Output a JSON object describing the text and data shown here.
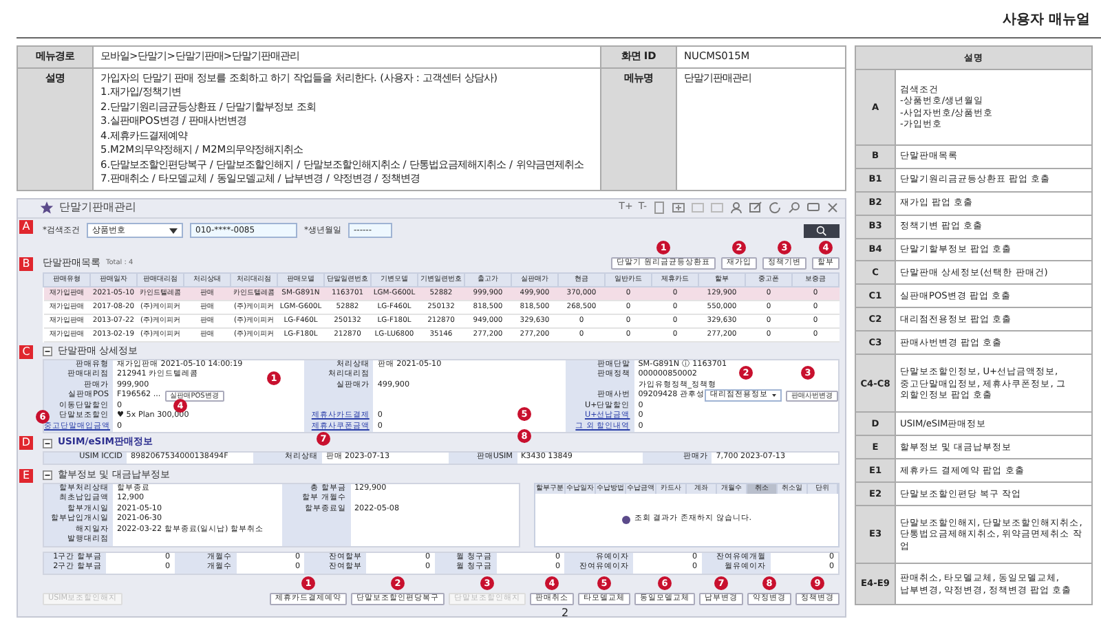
{
  "doc_title": "사용자 매뉴얼",
  "info": {
    "path_label": "메뉴경로",
    "path": "모바일>단말기>단말기판매>단말기판매관리",
    "screen_id_label": "화면 ID",
    "screen_id": "NUCMS015M",
    "desc_label": "설명",
    "desc_lines": [
      "가입자의 단말기 판매 정보를 조회하고 하기 작업들을 처리한다. (사용자 : 고객센터 상담사)",
      "1.재가입/정책기변",
      "2.단말기원리금균등상환표 / 단말기할부정보 조회",
      "3.실판매POS변경 / 판매사번변경",
      "4.제휴카드결제예약",
      "5.M2M의무약정해지 / M2M의무약정해지취소",
      "6.단말보조할인편당복구 / 단말보조할인해지 / 단말보조할인해지취소 / 단통법요금제해지취소 / 위약금면제취소",
      "7.판매취소 / 타모델교체 / 동일모델교체 / 납부변경 / 약정변경 / 정책변경"
    ],
    "menu_name_label": "메뉴명",
    "menu_name": "단말기판매관리"
  },
  "app": {
    "title": "단말기판매관리",
    "font_buttons": [
      "T+",
      "T-"
    ],
    "search": {
      "marker": "A",
      "label": "*검색조건",
      "select": "상품번호",
      "value": "010-****-0085",
      "birth_label": "*생년월일",
      "birth_value": "------"
    },
    "list": {
      "marker": "B",
      "title": "단말판매목록",
      "total": "Total : 4",
      "buttons": [
        {
          "label": "단말기 원리금균등상환표",
          "callout": "1"
        },
        {
          "label": "재가입",
          "callout": "2"
        },
        {
          "label": "정책기변",
          "callout": "3"
        },
        {
          "label": "할부",
          "callout": "4"
        }
      ],
      "columns": [
        "판매유형",
        "판매일자",
        "판매대리점",
        "처리상태",
        "처리대리점",
        "판매모델",
        "단말일련번호",
        "기변모델",
        "기변일련번호",
        "출고가",
        "실판매가",
        "현금",
        "일반카드",
        "제휴카드",
        "할부",
        "중고폰",
        "보증금"
      ],
      "rows": [
        {
          "selected": true,
          "cells": [
            "재가입판매",
            "2021-05-10",
            "카인드텔레콤",
            "판매",
            "카인드텔레콤",
            "SM-G891N",
            "1163701",
            "LGM-G600L",
            "52882",
            "999,900",
            "499,900",
            "370,000",
            "0",
            "0",
            "129,900",
            "0",
            "0"
          ]
        },
        {
          "selected": false,
          "cells": [
            "재가입판매",
            "2017-08-20",
            "(주)케이피커",
            "판매",
            "(주)케이피커",
            "LGM-G600L",
            "52882",
            "LG-F460L",
            "250132",
            "818,500",
            "818,500",
            "268,500",
            "0",
            "0",
            "550,000",
            "0",
            "0"
          ]
        },
        {
          "selected": false,
          "cells": [
            "재가입판매",
            "2013-07-22",
            "(주)케이피커",
            "판매",
            "(주)케이피커",
            "LG-F460L",
            "250132",
            "LG-F180L",
            "212870",
            "949,000",
            "329,630",
            "0",
            "0",
            "0",
            "329,630",
            "0",
            "0"
          ]
        },
        {
          "selected": false,
          "cells": [
            "재가입판매",
            "2013-02-19",
            "(주)케이피커",
            "판매",
            "(주)케이피커",
            "LG-F180L",
            "212870",
            "LG-LU6800",
            "35146",
            "277,200",
            "277,200",
            "0",
            "0",
            "0",
            "277,200",
            "0",
            "0"
          ]
        }
      ]
    },
    "detail": {
      "marker": "C",
      "title": "단말판매 상세정보",
      "callouts": [
        "1",
        "2",
        "3",
        "4",
        "5",
        "6",
        "7",
        "8"
      ],
      "rows": [
        [
          {
            "label": "판매유형",
            "value": "재가입판매 2021-05-10 14:00:19"
          },
          {
            "label": "처리상태",
            "value": "판매 2021-05-10"
          },
          {
            "label": "판매단말",
            "value": "SM-G891N ⓘ 1163701"
          }
        ],
        [
          {
            "label": "판매대리점",
            "value": "212941 카인드텔레콤"
          },
          {
            "label": "처리대리점"
          },
          {
            "label": "판매정책",
            "value": "000000850002"
          }
        ],
        [
          {
            "label": "판매가",
            "value": "999,900"
          },
          {
            "label": "실판매가",
            "value": "499,900"
          },
          {
            "value": "가입유형정책_정책형"
          }
        ],
        [
          {
            "label": "실판매POS",
            "value": "F196562 ...",
            "controls": [
              {
                "kind": "button",
                "label": "실판매POS변경"
              }
            ]
          },
          null,
          {
            "label": "판매사번",
            "value": "09209428 관후성",
            "controls": [
              {
                "kind": "select",
                "label": "대리점전용정보"
              },
              {
                "kind": "button",
                "label": "판매사번변경"
              }
            ]
          }
        ],
        [
          {
            "label": "이동단말할인",
            "value": "0"
          },
          null,
          {
            "label": "U+단말할인",
            "value": "0"
          }
        ],
        [
          {
            "label": "단말보조할인",
            "value": "♥ 5x Plan 300,000"
          },
          {
            "label": "제휴사카드결제",
            "value": "0",
            "link": true
          },
          {
            "label": "U+선납금액",
            "value": "0",
            "link": true
          }
        ],
        [
          {
            "label": "중고단말매입금액",
            "value": "0",
            "link": true
          },
          {
            "label": "제휴사쿠폰금액",
            "value": "0",
            "link": true
          },
          {
            "label": "그 외 할인내역",
            "value": "0",
            "link": true
          }
        ]
      ]
    },
    "usim": {
      "marker": "D",
      "title": "USIM/eSIM판매정보",
      "pairs": [
        {
          "label": "USIM ICCID",
          "value": "8982067534000138494F"
        },
        {
          "label": "처리상태",
          "value": "판매 2023-07-13"
        },
        {
          "label": "판매USIM",
          "value": "K3430 13849"
        },
        {
          "label": "판매가",
          "value": "7,700 2023-07-13"
        }
      ]
    },
    "install": {
      "marker": "E",
      "title": "할부정보 및 대금납부정보",
      "rows": [
        [
          {
            "label": "할부처리상태",
            "value": "할부종료"
          },
          {
            "label": "총 할부금",
            "value": "129,900"
          }
        ],
        [
          {
            "label": "최초납입금액",
            "value": "12,900"
          },
          {
            "label": "할부 개월수"
          }
        ],
        [
          {
            "label": "할부개시일",
            "value": "2021-05-10"
          },
          {
            "label": "할부종료일",
            "value": "2022-05-08"
          }
        ],
        [
          {
            "label": "할부납입개시일",
            "value": "2021-06-30"
          },
          null
        ],
        [
          {
            "label": "해지일자",
            "value": "2022-03-22  할부종료(일시납) 할부취소"
          },
          null
        ],
        [
          {
            "label": "발행대리점"
          },
          null
        ]
      ],
      "pay_columns": [
        {
          "label": "할부구분",
          "selected": false
        },
        {
          "label": "수납일자",
          "selected": false
        },
        {
          "label": "수납방법",
          "selected": false
        },
        {
          "label": "수납금액",
          "selected": false
        },
        {
          "label": "카드사",
          "selected": false
        },
        {
          "label": "계좌",
          "selected": false
        },
        {
          "label": "개월수",
          "selected": false
        },
        {
          "label": "취소",
          "selected": true
        },
        {
          "label": "취소일",
          "selected": false
        },
        {
          "label": "단위",
          "selected": false
        }
      ],
      "empty": "조회 결과가 존재하지 않습니다.",
      "sum_rows": [
        [
          {
            "label": "1구간 할부금",
            "value": "0"
          },
          {
            "label": "개월수",
            "value": "0"
          },
          {
            "label": "잔여할부",
            "value": "0"
          },
          {
            "label": "월 청구금",
            "value": "0"
          },
          {
            "label": "유예이자",
            "value": "0"
          },
          {
            "label": "잔여유예개월",
            "value": "0"
          }
        ],
        [
          {
            "label": "2구간 할부금",
            "value": "0"
          },
          {
            "label": "개월수",
            "value": "0"
          },
          {
            "label": "잔여할부",
            "value": "0"
          },
          {
            "label": "월 청구금",
            "value": "0"
          },
          {
            "label": "잔여유예이자",
            "value": "0"
          },
          {
            "label": "월유예이자",
            "value": "0"
          }
        ]
      ],
      "buttons": [
        {
          "label": "USIM보조할인해지",
          "disabled": true
        },
        {
          "label": "제휴카드결제예약",
          "disabled": false,
          "callout": "1"
        },
        {
          "label": "단말보조할인편당복구",
          "disabled": false,
          "callout": "2"
        },
        {
          "label": "단말보조할인해지",
          "disabled": true,
          "callout": "3"
        },
        {
          "label": "판매취소",
          "disabled": false,
          "callout": "4"
        },
        {
          "label": "타모델교체",
          "disabled": false,
          "callout": "5"
        },
        {
          "label": "동일모델교체",
          "disabled": false,
          "callout": "6"
        },
        {
          "label": "납부변경",
          "disabled": false,
          "callout": "7"
        },
        {
          "label": "약정변경",
          "disabled": false,
          "callout": "8"
        },
        {
          "label": "정책변경",
          "disabled": false,
          "callout": "9"
        }
      ]
    }
  },
  "legend": {
    "header": "설명",
    "rows": [
      {
        "code": "A",
        "text": "검색조건\n-상품번호/생년월일\n-사업자번호/상품번호\n-가입번호"
      },
      {
        "code": "B",
        "text": "단말판매목록"
      },
      {
        "code": "B1",
        "text": "단말기원리금균등상환표 팝업 호출"
      },
      {
        "code": "B2",
        "text": "재가입 팝업 호출"
      },
      {
        "code": "B3",
        "text": "정책기변 팝업 호출"
      },
      {
        "code": "B4",
        "text": "단말기할부정보 팝업 호출"
      },
      {
        "code": "C",
        "text": "단말판매 상세정보(선택한 판매건)"
      },
      {
        "code": "C1",
        "text": "실판매POS변경 팝업 호출"
      },
      {
        "code": "C2",
        "text": "대리점전용정보 팝업 호출"
      },
      {
        "code": "C3",
        "text": "판매사번변경 팝업 호출"
      },
      {
        "code": "C4-C8",
        "text": "단말보조할인정보, U+선납금액정보,\n중고단말매입정보, 제휴사쿠폰정보, 그\n외할인정보 팝업 호출"
      },
      {
        "code": "D",
        "text": "USIM/eSIM판매정보"
      },
      {
        "code": "E",
        "text": "할부정보 및 대금납부정보"
      },
      {
        "code": "E1",
        "text": "제휴카드 결제예약 팝업 호출"
      },
      {
        "code": "E2",
        "text": "단말보조할인편당 복구 작업"
      },
      {
        "code": "E3",
        "text": "단말보조할인해지, 단말보조할인해지취소,\n단통법요금제해지취소, 위약금면제취소 작업"
      },
      {
        "code": "E4-E9",
        "text": "판매취소, 타모델교체, 동일모델교체,\n납부변경, 약정변경, 정책변경 팝업 호출"
      }
    ]
  },
  "page_number": "2"
}
